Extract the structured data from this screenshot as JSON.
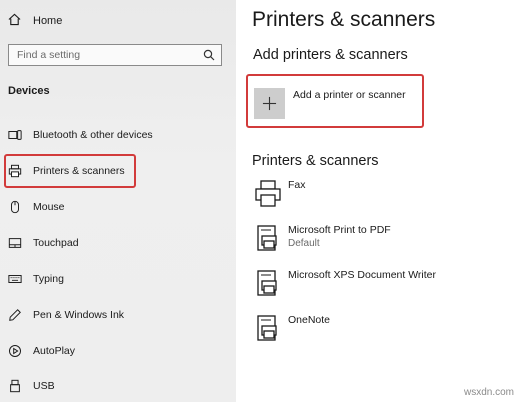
{
  "sidebar": {
    "home_label": "Home",
    "search_placeholder": "Find a setting",
    "section_title": "Devices",
    "items": [
      {
        "label": "Bluetooth & other devices",
        "icon": "bluetooth-devices-icon"
      },
      {
        "label": "Printers & scanners",
        "icon": "printer-icon",
        "selected": true
      },
      {
        "label": "Mouse",
        "icon": "mouse-icon"
      },
      {
        "label": "Touchpad",
        "icon": "touchpad-icon"
      },
      {
        "label": "Typing",
        "icon": "keyboard-icon"
      },
      {
        "label": "Pen & Windows Ink",
        "icon": "pen-icon"
      },
      {
        "label": "AutoPlay",
        "icon": "autoplay-icon"
      },
      {
        "label": "USB",
        "icon": "usb-icon"
      }
    ]
  },
  "main": {
    "title": "Printers & scanners",
    "add_section_title": "Add printers & scanners",
    "add_button_label": "Add a printer or scanner",
    "list_title": "Printers & scanners",
    "printers": [
      {
        "name": "Fax",
        "status": "",
        "icon": "fax-icon"
      },
      {
        "name": "Microsoft Print to PDF",
        "status": "Default",
        "icon": "printer-document-icon"
      },
      {
        "name": "Microsoft XPS Document Writer",
        "status": "",
        "icon": "printer-document-icon"
      },
      {
        "name": "OneNote",
        "status": "",
        "icon": "printer-document-icon"
      }
    ]
  },
  "watermark": "wsxdn.com",
  "colors": {
    "highlight": "#d23b3b",
    "sidebar_bg": "#ececec",
    "tile_bg": "#cdcdcd"
  }
}
